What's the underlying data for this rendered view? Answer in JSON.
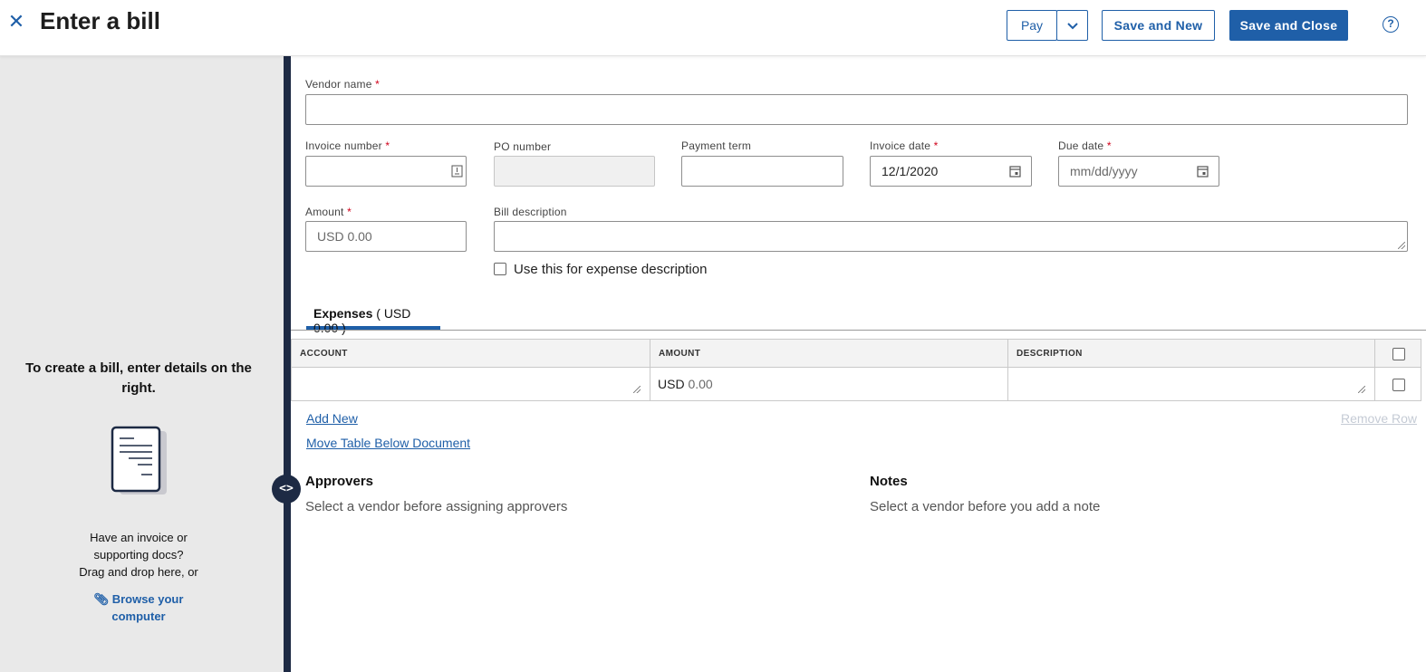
{
  "header": {
    "close_icon": "close-icon",
    "title": "Enter a bill",
    "pay_label": "Pay",
    "save_new_label": "Save and New",
    "save_close_label": "Save and Close",
    "help_icon": "?"
  },
  "left_panel": {
    "heading": "To create a bill, enter details on the right.",
    "upload_text_1": "Have an invoice or",
    "upload_text_2": "supporting docs?",
    "upload_text_3": "Drag and drop here, or",
    "browse_label": "Browse your computer",
    "toggle_glyph": "<>"
  },
  "form": {
    "vendor_name": {
      "label": "Vendor name",
      "required": "*",
      "value": ""
    },
    "invoice_number": {
      "label": "Invoice number",
      "required": "*",
      "value": ""
    },
    "po_number": {
      "label": "PO number",
      "value": ""
    },
    "payment_term": {
      "label": "Payment term",
      "value": ""
    },
    "invoice_date": {
      "label": "Invoice date",
      "required": "*",
      "value": "12/1/2020"
    },
    "due_date": {
      "label": "Due date",
      "required": "*",
      "placeholder": "mm/dd/yyyy"
    },
    "amount": {
      "label": "Amount",
      "required": "*",
      "placeholder": "USD 0.00"
    },
    "bill_description": {
      "label": "Bill description",
      "value": ""
    },
    "expense_desc_checkbox": {
      "label": "Use this for expense description",
      "checked": false
    }
  },
  "tabs": [
    {
      "label": "Expenses",
      "amount": "( USD 0.00 )"
    }
  ],
  "table": {
    "columns": [
      "ACCOUNT",
      "AMOUNT",
      "DESCRIPTION"
    ],
    "rows": [
      {
        "account": "",
        "currency": "USD",
        "amount_placeholder": "0.00",
        "description": ""
      }
    ]
  },
  "actions": {
    "add_new": "Add New",
    "remove_row": "Remove Row",
    "move_table": "Move Table Below Document"
  },
  "approvers": {
    "title": "Approvers",
    "text": "Select a vendor before assigning approvers"
  },
  "notes": {
    "title": "Notes",
    "text": "Select a vendor before you add a note"
  },
  "colors": {
    "accent": "#1f5fa8",
    "sidebar_bg": "#e9e9e9",
    "divider": "#1d2a44",
    "required": "#d0021b"
  }
}
